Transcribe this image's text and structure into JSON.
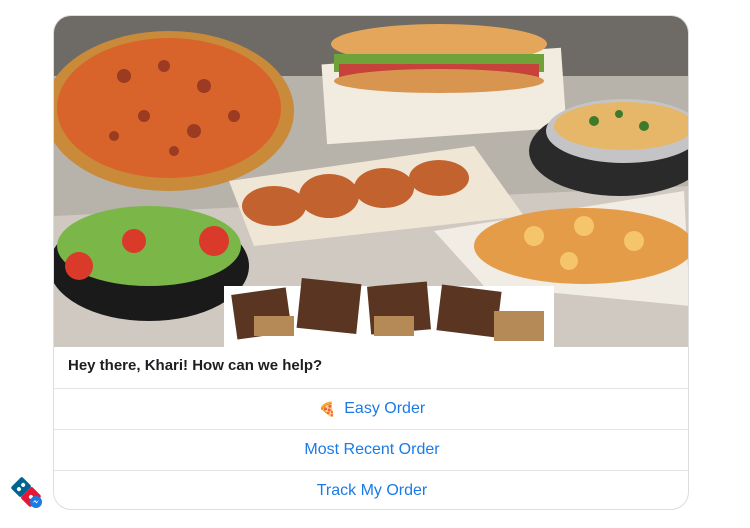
{
  "greeting": "Hey there, Khari! How can we help?",
  "hero_image": "Domino's menu food spread (pizza, sandwich, pasta, wings, salad, cheesy bread, brownies)",
  "buttons": {
    "easy_order": {
      "icon": "pizza-slice-icon",
      "label": "Easy Order"
    },
    "most_recent": {
      "label": "Most Recent Order"
    },
    "track": {
      "label": "Track My Order"
    }
  },
  "colors": {
    "link": "#1a7be6",
    "domino_blue": "#006491",
    "domino_red": "#e31837"
  },
  "logo": "dominos-logo-icon"
}
